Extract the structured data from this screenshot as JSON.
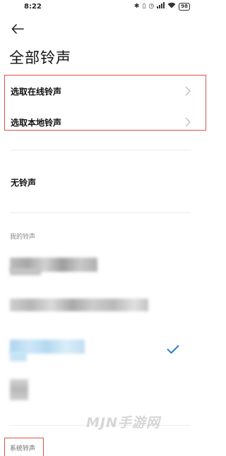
{
  "status_bar": {
    "time": "8:22",
    "icons": [
      "bluetooth-icon",
      "vibrate-icon",
      "alarm-icon",
      "signal-icon",
      "wifi-icon"
    ],
    "battery": "98"
  },
  "header": {
    "title": "全部铃声"
  },
  "menu": {
    "online_label": "选取在线铃声",
    "local_label": "选取本地铃声"
  },
  "no_ringtone_label": "无铃声",
  "my_ringtones": {
    "section_title": "我的铃声",
    "selected_index": 2
  },
  "system_ringtones": {
    "section_title": "系统铃声"
  },
  "watermark": "MJN手游网",
  "colors": {
    "highlight": "#e0504a",
    "check": "#2f7fd8"
  }
}
